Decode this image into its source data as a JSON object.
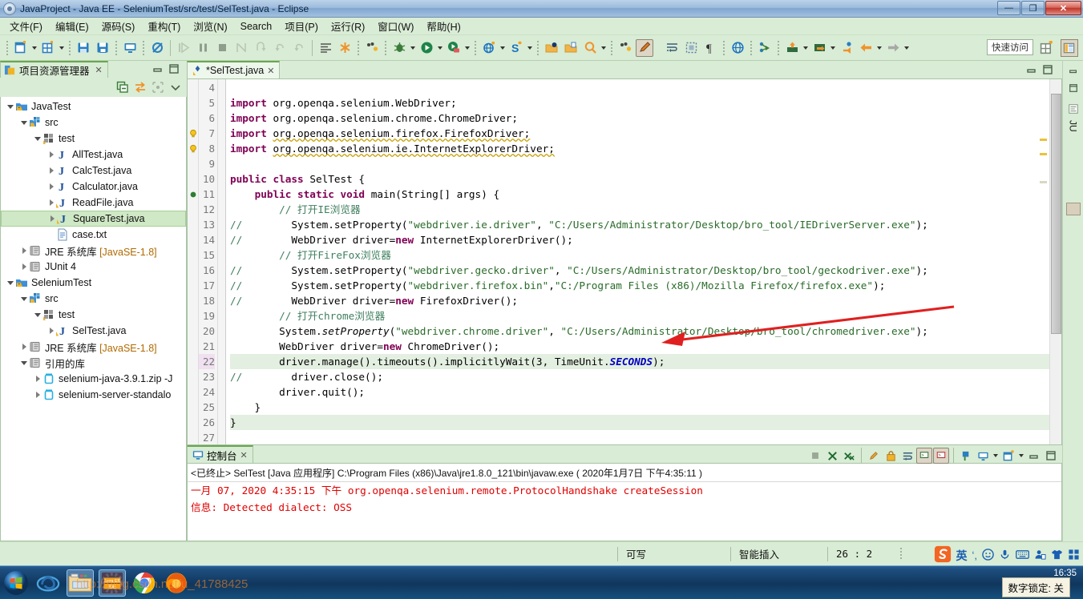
{
  "window": {
    "title": "JavaProject  -  Java EE  -  SeleniumTest/src/test/SelTest.java  -  Eclipse",
    "minimize": "—",
    "maximize": "❐",
    "close": "✕"
  },
  "menubar": {
    "items": [
      {
        "label": "文件(F)",
        "name": "menu-file"
      },
      {
        "label": "编辑(E)",
        "name": "menu-edit"
      },
      {
        "label": "源码(S)",
        "name": "menu-source"
      },
      {
        "label": "重构(T)",
        "name": "menu-refactor"
      },
      {
        "label": "浏览(N)",
        "name": "menu-navigate"
      },
      {
        "label": "Search",
        "name": "menu-search"
      },
      {
        "label": "项目(P)",
        "name": "menu-project"
      },
      {
        "label": "运行(R)",
        "name": "menu-run"
      },
      {
        "label": "窗口(W)",
        "name": "menu-window"
      },
      {
        "label": "帮助(H)",
        "name": "menu-help"
      }
    ]
  },
  "toolbar": {
    "quick_access": "快速访问",
    "icons": [
      "new-wizard-icon",
      "new-menu-caret",
      "new-grid-icon",
      "new-grid-caret",
      "save-icon",
      "save-all-icon",
      "open-perspective-icon",
      "skip-breakpoints-icon",
      "resume-icon",
      "suspend-icon",
      "terminate-icon",
      "step-into-icon",
      "step-over-icon",
      "step-return-icon",
      "step-return-alt-icon",
      "show-whitespace-icon",
      "toggle-mark-occurrences-icon",
      "debug-last-icon",
      "debug-icon",
      "debug-caret",
      "run-icon",
      "run-caret",
      "coverage-icon",
      "coverage-caret",
      "new-web-project-icon",
      "new-web-caret",
      "new-server-icon",
      "new-server-caret",
      "open-type-icon",
      "open-task-icon",
      "search-icon",
      "search-caret",
      "external-tools-icon",
      "edit-icon",
      "toggle-word-wrap-icon",
      "toggle-block-selection-icon",
      "show-whitespace-chars-icon",
      "web-browser-icon",
      "link-icon",
      "export-icon",
      "export-caret",
      "import-icon",
      "import-caret",
      "back-dot-icon",
      "back-arrow-icon",
      "back-caret",
      "forward-arrow-icon",
      "forward-caret"
    ],
    "perspective_new": "open-perspective-button",
    "perspective_javaee": "javaee-perspective-button"
  },
  "explorer": {
    "tab_label": "项目资源管理器",
    "tab_close": "✕",
    "toolbar_icons": [
      "collapse-all-icon",
      "link-with-editor-icon",
      "focus-icon",
      "view-menu-icon"
    ],
    "minimize": "minimize-view-icon",
    "maximize": "maximize-view-icon",
    "tree": [
      {
        "label": "JavaTest",
        "indent": 0,
        "arrow": "open",
        "icon": "project-icon",
        "selected": false
      },
      {
        "label": "src",
        "indent": 1,
        "arrow": "open",
        "icon": "source-folder-icon",
        "selected": false
      },
      {
        "label": "test",
        "indent": 2,
        "arrow": "open",
        "icon": "package-icon",
        "selected": false
      },
      {
        "label": "AllTest.java",
        "indent": 3,
        "arrow": "closed",
        "icon": "java-file-icon",
        "selected": false
      },
      {
        "label": "CalcTest.java",
        "indent": 3,
        "arrow": "closed",
        "icon": "java-file-icon",
        "selected": false
      },
      {
        "label": "Calculator.java",
        "indent": 3,
        "arrow": "closed",
        "icon": "java-file-icon",
        "selected": false
      },
      {
        "label": "ReadFile.java",
        "indent": 3,
        "arrow": "closed",
        "icon": "java-file-warning-icon",
        "selected": false
      },
      {
        "label": "SquareTest.java",
        "indent": 3,
        "arrow": "closed",
        "icon": "java-file-warning-icon",
        "selected": true
      },
      {
        "label": "case.txt",
        "indent": 3,
        "arrow": "none",
        "icon": "text-file-icon",
        "selected": false
      },
      {
        "label": "JRE 系统库 ",
        "suffix": "[JavaSE-1.8]",
        "indent": 1,
        "arrow": "closed",
        "icon": "library-icon",
        "selected": false
      },
      {
        "label": "JUnit 4",
        "indent": 1,
        "arrow": "closed",
        "icon": "library-icon",
        "selected": false
      },
      {
        "label": "SeleniumTest",
        "indent": 0,
        "arrow": "open",
        "icon": "project-icon",
        "selected": false
      },
      {
        "label": "src",
        "indent": 1,
        "arrow": "open",
        "icon": "source-folder-icon",
        "selected": false
      },
      {
        "label": "test",
        "indent": 2,
        "arrow": "open",
        "icon": "package-icon",
        "selected": false
      },
      {
        "label": "SelTest.java",
        "indent": 3,
        "arrow": "closed",
        "icon": "java-file-warning-icon",
        "selected": false
      },
      {
        "label": "JRE 系统库 ",
        "suffix": "[JavaSE-1.8]",
        "indent": 1,
        "arrow": "closed",
        "icon": "library-icon",
        "selected": false
      },
      {
        "label": "引用的库",
        "indent": 1,
        "arrow": "open",
        "icon": "library-icon",
        "selected": false
      },
      {
        "label": "selenium-java-3.9.1.zip -J",
        "indent": 2,
        "arrow": "closed",
        "icon": "jar-icon",
        "selected": false
      },
      {
        "label": "selenium-server-standalo",
        "indent": 2,
        "arrow": "closed",
        "icon": "jar-icon",
        "selected": false
      }
    ]
  },
  "editor": {
    "tab_label": "*SelTest.java",
    "tab_close": "✕",
    "tab_icon": "java-file-warning-icon",
    "minimize": "minimize-editor-icon",
    "maximize": "maximize-editor-icon",
    "lines": [
      {
        "n": "4",
        "marker": "",
        "segs": []
      },
      {
        "n": "5",
        "marker": "",
        "segs": [
          {
            "t": "import ",
            "c": "kw"
          },
          {
            "t": "org.openqa.selenium.WebDriver;",
            "c": ""
          }
        ]
      },
      {
        "n": "6",
        "marker": "",
        "segs": [
          {
            "t": "import ",
            "c": "kw"
          },
          {
            "t": "org.openqa.selenium.chrome.ChromeDriver;",
            "c": ""
          }
        ]
      },
      {
        "n": "7",
        "marker": "bulb",
        "segs": [
          {
            "t": "import ",
            "c": "kw"
          },
          {
            "t": "org.openqa.selenium.firefox.FirefoxDriver;",
            "c": "err"
          }
        ]
      },
      {
        "n": "8",
        "marker": "bulb",
        "segs": [
          {
            "t": "import ",
            "c": "kw"
          },
          {
            "t": "org.openqa.selenium.ie.InternetExplorerDriver;",
            "c": "err"
          }
        ]
      },
      {
        "n": "9",
        "marker": "",
        "segs": []
      },
      {
        "n": "10",
        "marker": "",
        "segs": [
          {
            "t": "public class ",
            "c": "kw"
          },
          {
            "t": "SelTest {",
            "c": ""
          }
        ]
      },
      {
        "n": "11",
        "marker": "overridedot",
        "segs": [
          {
            "t": "    ",
            "c": ""
          },
          {
            "t": "public static void ",
            "c": "kw"
          },
          {
            "t": "main(String[] args) {",
            "c": ""
          }
        ]
      },
      {
        "n": "12",
        "marker": "",
        "segs": [
          {
            "t": "        // 打开IE浏览器",
            "c": "cmt"
          }
        ]
      },
      {
        "n": "13",
        "marker": "",
        "segs": [
          {
            "t": "//",
            "c": "cmt"
          },
          {
            "t": "        System.setProperty(",
            "c": ""
          },
          {
            "t": "\"webdriver.ie.driver\"",
            "c": "str"
          },
          {
            "t": ", ",
            "c": ""
          },
          {
            "t": "\"C:/Users/Administrator/Desktop/bro_tool/IEDriverServer.exe\"",
            "c": "str"
          },
          {
            "t": ");",
            "c": ""
          }
        ]
      },
      {
        "n": "14",
        "marker": "",
        "segs": [
          {
            "t": "//",
            "c": "cmt"
          },
          {
            "t": "        WebDriver driver=",
            "c": ""
          },
          {
            "t": "new ",
            "c": "kw"
          },
          {
            "t": "InternetExplorerDriver();",
            "c": ""
          }
        ]
      },
      {
        "n": "15",
        "marker": "",
        "segs": [
          {
            "t": "        // 打开FireFox浏览器",
            "c": "cmt"
          }
        ]
      },
      {
        "n": "16",
        "marker": "",
        "segs": [
          {
            "t": "//",
            "c": "cmt"
          },
          {
            "t": "        System.setProperty(",
            "c": ""
          },
          {
            "t": "\"webdriver.gecko.driver\"",
            "c": "str"
          },
          {
            "t": ", ",
            "c": ""
          },
          {
            "t": "\"C:/Users/Administrator/Desktop/bro_tool/geckodriver.exe\"",
            "c": "str"
          },
          {
            "t": ");",
            "c": ""
          }
        ]
      },
      {
        "n": "17",
        "marker": "",
        "segs": [
          {
            "t": "//",
            "c": "cmt"
          },
          {
            "t": "        System.setProperty(",
            "c": ""
          },
          {
            "t": "\"webdriver.firefox.bin\"",
            "c": "str"
          },
          {
            "t": ",",
            "c": ""
          },
          {
            "t": "\"C:/Program Files (x86)/Mozilla Firefox/firefox.exe\"",
            "c": "str"
          },
          {
            "t": ");",
            "c": ""
          }
        ]
      },
      {
        "n": "18",
        "marker": "",
        "segs": [
          {
            "t": "//",
            "c": "cmt"
          },
          {
            "t": "        WebDriver driver=",
            "c": ""
          },
          {
            "t": "new ",
            "c": "kw"
          },
          {
            "t": "FirefoxDriver();",
            "c": ""
          }
        ]
      },
      {
        "n": "19",
        "marker": "",
        "segs": [
          {
            "t": "        // 打开chrome浏览器",
            "c": "cmt"
          }
        ]
      },
      {
        "n": "20",
        "marker": "",
        "segs": [
          {
            "t": "        System.",
            "c": ""
          },
          {
            "t": "setProperty",
            "c": "stat"
          },
          {
            "t": "(",
            "c": ""
          },
          {
            "t": "\"webdriver.chrome.driver\"",
            "c": "str"
          },
          {
            "t": ", ",
            "c": ""
          },
          {
            "t": "\"C:/Users/Administrator/Desktop/bro_tool/chromedriver.exe\"",
            "c": "str"
          },
          {
            "t": ");",
            "c": ""
          }
        ]
      },
      {
        "n": "21",
        "marker": "",
        "segs": [
          {
            "t": "        WebDriver driver=",
            "c": ""
          },
          {
            "t": "new ",
            "c": "kw"
          },
          {
            "t": "ChromeDriver();",
            "c": ""
          }
        ]
      },
      {
        "n": "22",
        "marker": "",
        "segs": [
          {
            "t": "        driver.manage().timeouts().implicitlyWait(3, TimeUnit.",
            "c": ""
          },
          {
            "t": "SECONDS",
            "c": "fld"
          },
          {
            "t": ");",
            "c": ""
          }
        ],
        "current": true
      },
      {
        "n": "23",
        "marker": "",
        "segs": [
          {
            "t": "//",
            "c": "cmt"
          },
          {
            "t": "        driver.close();",
            "c": ""
          }
        ]
      },
      {
        "n": "24",
        "marker": "",
        "segs": [
          {
            "t": "        driver.quit();",
            "c": ""
          }
        ]
      },
      {
        "n": "25",
        "marker": "",
        "segs": [
          {
            "t": "    }",
            "c": ""
          }
        ]
      },
      {
        "n": "26",
        "marker": "",
        "segs": [
          {
            "t": "}",
            "c": ""
          }
        ],
        "highlight": true
      },
      {
        "n": "27",
        "marker": "",
        "segs": []
      }
    ]
  },
  "console": {
    "tab_label": "控制台",
    "tab_close": "✕",
    "header": "<已终止> SelTest [Java 应用程序] C:\\Program Files (x86)\\Java\\jre1.8.0_121\\bin\\javaw.exe ( 2020年1月7日 下午4:35:11 )",
    "output": [
      "一月 07, 2020 4:35:15 下午 org.openqa.selenium.remote.ProtocolHandshake createSession",
      "信息: Detected dialect: OSS"
    ],
    "toolbar_icons": [
      "terminate-icon",
      "remove-launch-icon",
      "remove-all-launches-icon",
      "clear-console-icon",
      "lock-scroll-icon",
      "word-wrap-icon",
      "show-console-on-output-icon",
      "show-console-on-error-icon",
      "pin-console-icon",
      "display-selected-console-icon",
      "display-console-caret",
      "open-console-icon",
      "open-console-caret",
      "minimize-icon",
      "maximize-icon"
    ]
  },
  "statusbar": {
    "writable": "可写",
    "insert_mode": "智能插入",
    "position": "26 : 2"
  },
  "tray": {
    "ime_icons": [
      "sogou-logo-icon",
      "ime-chinese-icon",
      "ime-punctuation-icon",
      "ime-emoji-icon",
      "ime-voice-icon",
      "ime-keyboard-icon",
      "ime-user-icon",
      "ime-skin-icon",
      "ime-toolbox-icon"
    ],
    "numlock_tip": "数字锁定: 关",
    "clock_time": "16:35",
    "watermark": "http://blog.csdn.net/u_41788425"
  },
  "taskbar": {
    "items": [
      {
        "name": "start-button",
        "label": "start-orb-icon"
      },
      {
        "name": "taskbar-ie",
        "label": "internet-explorer-icon"
      },
      {
        "name": "taskbar-explorer",
        "label": "file-explorer-icon"
      },
      {
        "name": "taskbar-eclipse",
        "label": "java-ee-ide-icon"
      },
      {
        "name": "taskbar-chrome",
        "label": "chrome-icon"
      },
      {
        "name": "taskbar-firefox",
        "label": "firefox-icon"
      }
    ]
  },
  "colors": {
    "toolbar_bg": "#d9ecd5",
    "tab_active_border": "#6aa84f",
    "selection": "#cfe8c5",
    "console_error": "#e00000",
    "keyword": "#7f0055",
    "string": "#2a6b2a",
    "comment": "#3f7f5f",
    "field": "#0000c0",
    "annotation_arrow": "#e02020"
  }
}
